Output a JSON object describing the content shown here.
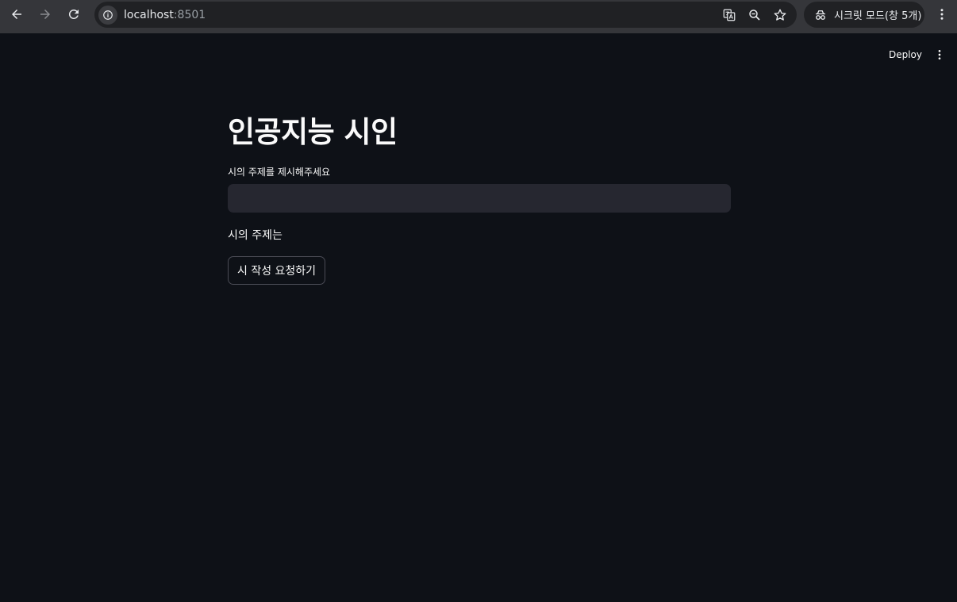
{
  "browser": {
    "url_host": "localhost",
    "url_port": ":8501",
    "incognito_label": "시크릿 모드(창 5개)"
  },
  "app": {
    "deploy_label": "Deploy",
    "title": "인공지능 시인",
    "input_label": "시의 주제를 제시해주세요",
    "input_value": "",
    "subject_text": "시의 주제는",
    "button_label": "시 작성 요청하기"
  },
  "icons": {
    "back": "arrow-left-icon",
    "forward": "arrow-right-icon",
    "reload": "reload-icon",
    "site_info": "info-icon",
    "translate": "translate-icon",
    "zoom": "zoom-icon",
    "bookmark": "star-icon",
    "incognito": "incognito-icon",
    "menu": "more-vertical-icon"
  },
  "colors": {
    "app_background": "#0e1117",
    "input_background": "#262730",
    "chrome_background": "#35363a"
  }
}
